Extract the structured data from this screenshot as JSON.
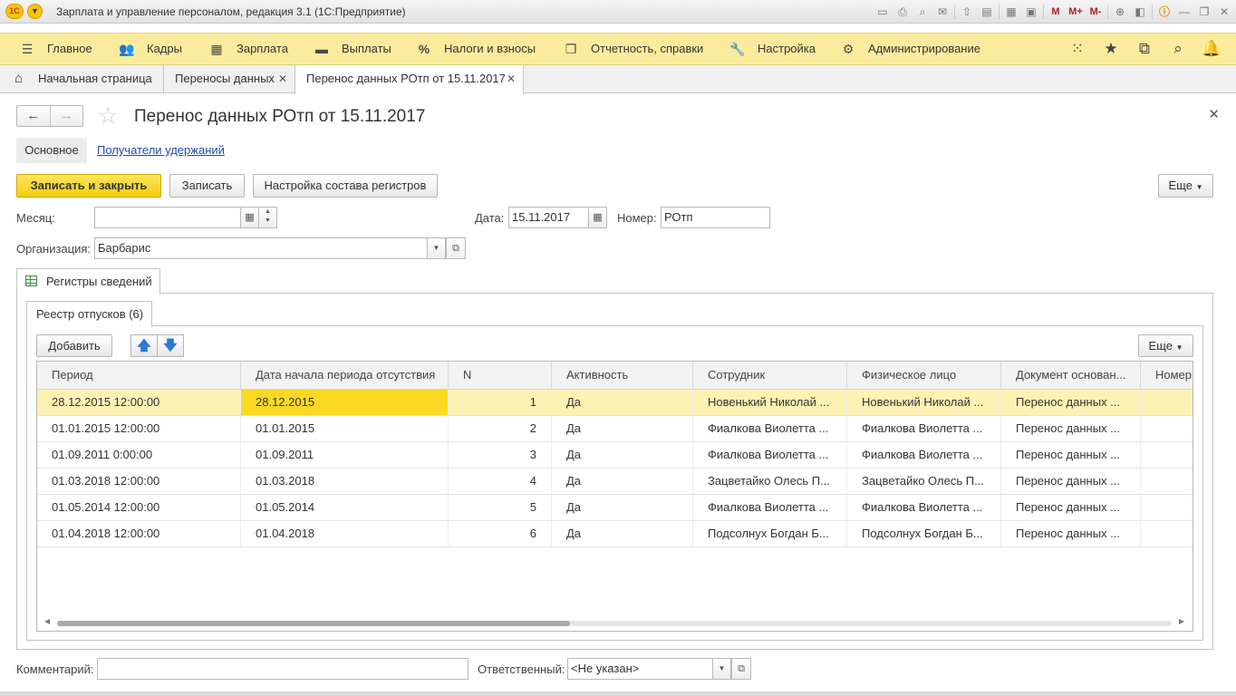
{
  "window": {
    "title": "Зарплата и управление персоналом, редакция 3.1  (1С:Предприятие)",
    "logo_text": "1С",
    "toolbar_labels": {
      "m": "M",
      "mplus": "M+",
      "mminus": "M-"
    }
  },
  "sections": [
    {
      "label": "Главное",
      "icon": "menu-icon"
    },
    {
      "label": "Кадры",
      "icon": "people-icon"
    },
    {
      "label": "Зарплата",
      "icon": "calculator-icon"
    },
    {
      "label": "Выплаты",
      "icon": "wallet-icon"
    },
    {
      "label": "Налоги и взносы",
      "icon": "percent-icon"
    },
    {
      "label": "Отчетность, справки",
      "icon": "reports-icon"
    },
    {
      "label": "Настройка",
      "icon": "wrench-icon"
    },
    {
      "label": "Администрирование",
      "icon": "gear-icon"
    }
  ],
  "open_tabs": [
    {
      "label": "Начальная страница",
      "icon": "home-icon"
    },
    {
      "label": "Переносы данных",
      "closable": true
    },
    {
      "label": "Перенос данных РОтп от 15.11.2017",
      "closable": true,
      "active": true
    }
  ],
  "form": {
    "title": "Перенос данных РОтп от 15.11.2017",
    "nav_main": "Основное",
    "nav_link": "Получатели удержаний",
    "buttons": {
      "save_close": "Записать и закрыть",
      "save": "Записать",
      "registers_setup": "Настройка состава регистров",
      "more": "Еще"
    },
    "fields": {
      "month_label": "Месяц:",
      "month_value": "",
      "date_label": "Дата:",
      "date_value": "15.11.2017",
      "number_label": "Номер:",
      "number_value": "РОтп",
      "org_label": "Организация:",
      "org_value": "Барбарис",
      "comment_label": "Комментарий:",
      "comment_value": "",
      "responsible_label": "Ответственный:",
      "responsible_value": "<Не указан>"
    },
    "main_tab": "Регистры сведений",
    "sub_tab": "Реестр отпусков (6)",
    "table_buttons": {
      "add": "Добавить",
      "more": "Еще"
    },
    "table": {
      "columns": [
        "Период",
        "Дата начала периода отсутствия",
        "N",
        "Активность",
        "Сотрудник",
        "Физическое лицо",
        "Документ основан...",
        "Номер"
      ],
      "rows": [
        [
          "28.12.2015 12:00:00",
          "28.12.2015",
          "1",
          "Да",
          "Новенький Николай ...",
          "Новенький Николай ...",
          "Перенос данных ...",
          ""
        ],
        [
          "01.01.2015 12:00:00",
          "01.01.2015",
          "2",
          "Да",
          "Фиалкова Виолетта ...",
          "Фиалкова Виолетта ...",
          "Перенос данных ...",
          ""
        ],
        [
          "01.09.2011 0:00:00",
          "01.09.2011",
          "3",
          "Да",
          "Фиалкова Виолетта ...",
          "Фиалкова Виолетта ...",
          "Перенос данных ...",
          ""
        ],
        [
          "01.03.2018 12:00:00",
          "01.03.2018",
          "4",
          "Да",
          "Зацветайко Олесь П...",
          "Зацветайко Олесь П...",
          "Перенос данных ...",
          ""
        ],
        [
          "01.05.2014 12:00:00",
          "01.05.2014",
          "5",
          "Да",
          "Фиалкова Виолетта ...",
          "Фиалкова Виолетта ...",
          "Перенос данных ...",
          ""
        ],
        [
          "01.04.2018 12:00:00",
          "01.04.2018",
          "6",
          "Да",
          "Подсолнух Богдан Б...",
          "Подсолнух Богдан Б...",
          "Перенос данных ...",
          ""
        ]
      ],
      "selected_row": 0,
      "scroll_position": 0.45
    }
  },
  "colors": {
    "sections_bg": "#fbec9d",
    "primary_button": "#f4cc0e",
    "selected_row": "#fcf2b4",
    "current_cell": "#fbd922",
    "link": "#1f4aa8"
  }
}
